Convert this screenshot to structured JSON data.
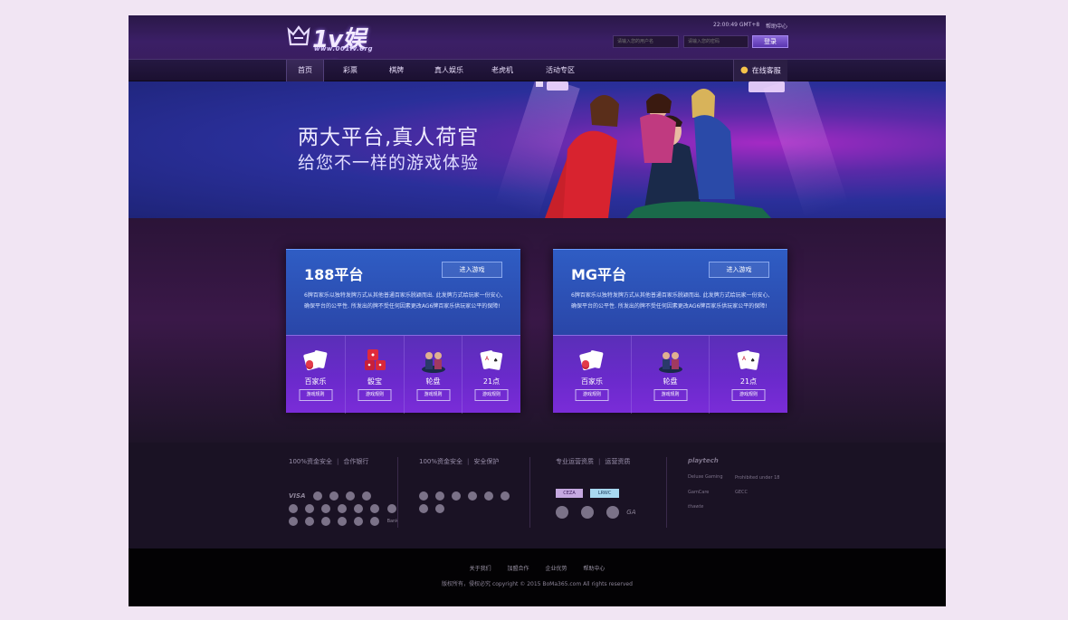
{
  "header": {
    "logo_text": "1v娱乐",
    "logo_url": "www.001lv.org",
    "clock": "22:00:49  GMT+8",
    "help": "帮助中心",
    "username_placeholder": "请输入您的用户名",
    "password_placeholder": "请输入您的密码",
    "login_label": "登录"
  },
  "nav": {
    "items": [
      {
        "label": "首页"
      },
      {
        "label": "彩票"
      },
      {
        "label": "棋牌"
      },
      {
        "label": "真人娱乐"
      },
      {
        "label": "老虎机"
      },
      {
        "label": "活动专区"
      }
    ],
    "service_label": "在线客服"
  },
  "banner": {
    "title": "两大平台,真人荷官",
    "subtitle": "给您不一样的游戏体验"
  },
  "platforms": [
    {
      "title": "188平台",
      "enter_label": "进入游戏",
      "description": "6牌百家乐以独特发牌方式从其他普通百家乐脱颖而出. 此发牌方式给玩家一份安心, 确保平台的公平性. 所发出的牌不受任何因素更改AG6牌百家乐供玩家公平的保障!",
      "games": [
        {
          "name": "百家乐",
          "rule": "游戏规则",
          "icon": "baccarat-icon"
        },
        {
          "name": "骰宝",
          "rule": "游戏规则",
          "icon": "dice-icon"
        },
        {
          "name": "轮盘",
          "rule": "游戏规则",
          "icon": "roulette-icon"
        },
        {
          "name": "21点",
          "rule": "游戏规则",
          "icon": "blackjack-icon"
        }
      ]
    },
    {
      "title": "MG平台",
      "enter_label": "进入游戏",
      "description": "6牌百家乐以独特发牌方式从其他普通百家乐脱颖而出. 此发牌方式给玩家一份安心, 确保平台的公平性. 所发出的牌不受任何因素更改AG6牌百家乐供玩家公平的保障!",
      "games": [
        {
          "name": "百家乐",
          "rule": "游戏规则",
          "icon": "baccarat-icon"
        },
        {
          "name": "轮盘",
          "rule": "游戏规则",
          "icon": "roulette-icon"
        },
        {
          "name": "21点",
          "rule": "游戏规则",
          "icon": "blackjack-icon"
        }
      ]
    }
  ],
  "partners": {
    "col1": {
      "a": "100%资金安全",
      "b": "合作银行",
      "row1": "VISA",
      "row3": "Bank"
    },
    "col2": {
      "a": "100%资金安全",
      "b": "安全保护"
    },
    "col3": {
      "a": "专业运营资质",
      "b": "运营资质",
      "ceza": "CEZA",
      "lrwc": "LRWC",
      "ga": "GA"
    },
    "col4": {
      "playtech": "playtech",
      "deluxe": "Deluxe Gaming",
      "prohibited": "Prohibited under 18",
      "gamcare": "GamCare",
      "gecc": "GECC",
      "thawte": "thawte"
    }
  },
  "footer": {
    "links": [
      "关于我们",
      "加盟合作",
      "企业优势",
      "帮助中心"
    ],
    "copyright": "版权所有，侵权必究 copyright © 2015 BoMa365.com All rights reserved"
  },
  "colors": {
    "page_bg": "#f1e5f3",
    "header": "#3b1f66",
    "platform_top": "#2f5dc4",
    "platform_bottom": "#6a2acb",
    "footer": "#030204"
  }
}
